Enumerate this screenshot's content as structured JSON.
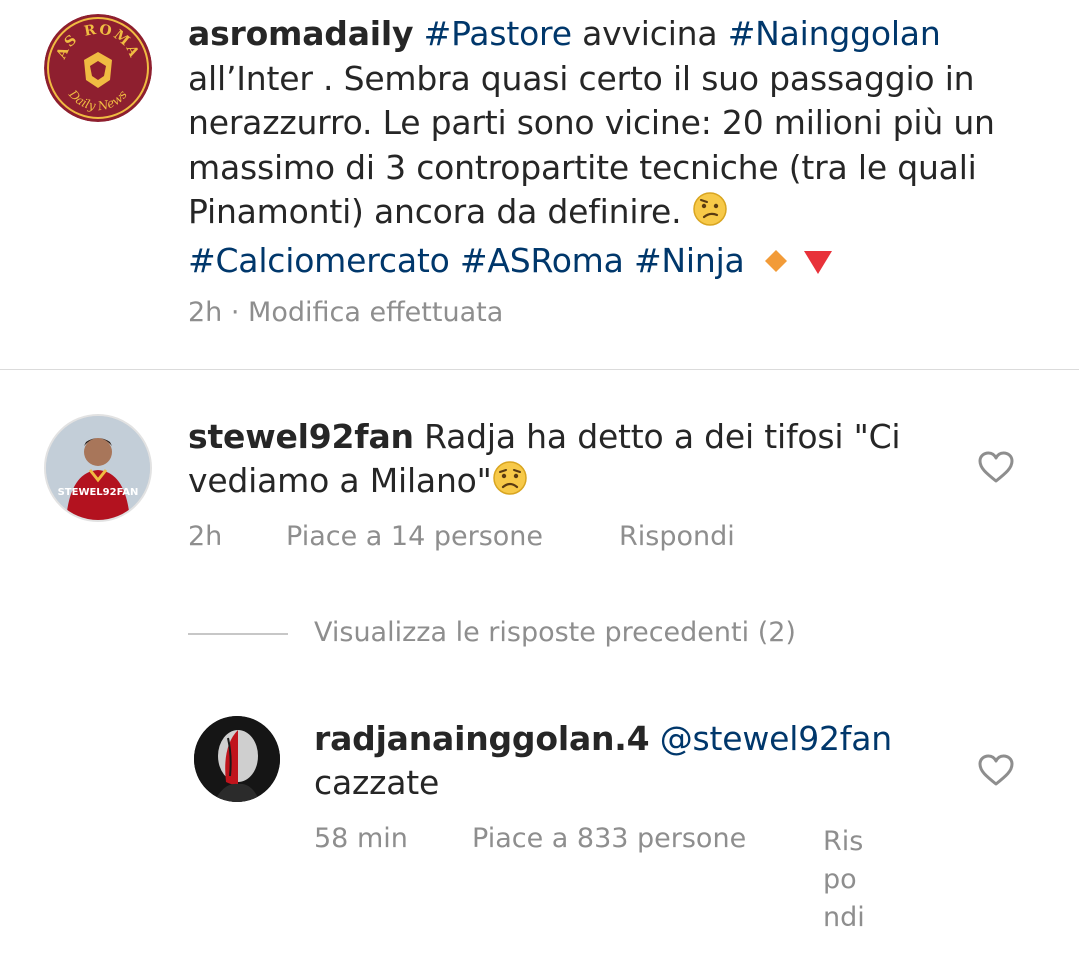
{
  "post": {
    "username": "asromadaily",
    "line1_tag1": "#Pastore",
    "line1_mid": " avvicina ",
    "line1_tag2": "#Nainggolan",
    "body": "all’Inter . Sembra quasi certo il suo passaggio in nerazzurro.  Le parti sono vicine: 20 milioni più un massimo di 3 contropartite tecniche (tra le quali Pinamonti) ancora da definire.",
    "hashtags": [
      "#Calciomercato",
      "#ASRoma",
      "#Ninja"
    ],
    "meta": "2h · Modifica effettuata",
    "avatar_logo": {
      "top": "AS ROMA",
      "bottom": "Daily News"
    }
  },
  "comments": [
    {
      "username": "stewel92fan",
      "text": "Radja ha detto a dei tifosi \"Ci vediamo a Milano\"",
      "time": "2h",
      "likes": "Piace a 14 persone",
      "reply": "Rispondi",
      "avatar_caption": "STEWEL92FAN"
    }
  ],
  "view_replies": "Visualizza le risposte precedenti (2)",
  "reply": {
    "username": "radjanainggolan.4",
    "mention": "@stewel92fan",
    "text": "cazzate",
    "time": "58 min",
    "likes": "Piace a 833 persone",
    "reply_lines": [
      "Ris",
      "po",
      "ndi"
    ]
  },
  "icons": {
    "like": "heart-outline-icon"
  },
  "colors": {
    "hashtag": "#00376b",
    "meta": "#8e8e8e",
    "roma_red": "#8e1f2f",
    "roma_gold": "#f0bc42"
  }
}
